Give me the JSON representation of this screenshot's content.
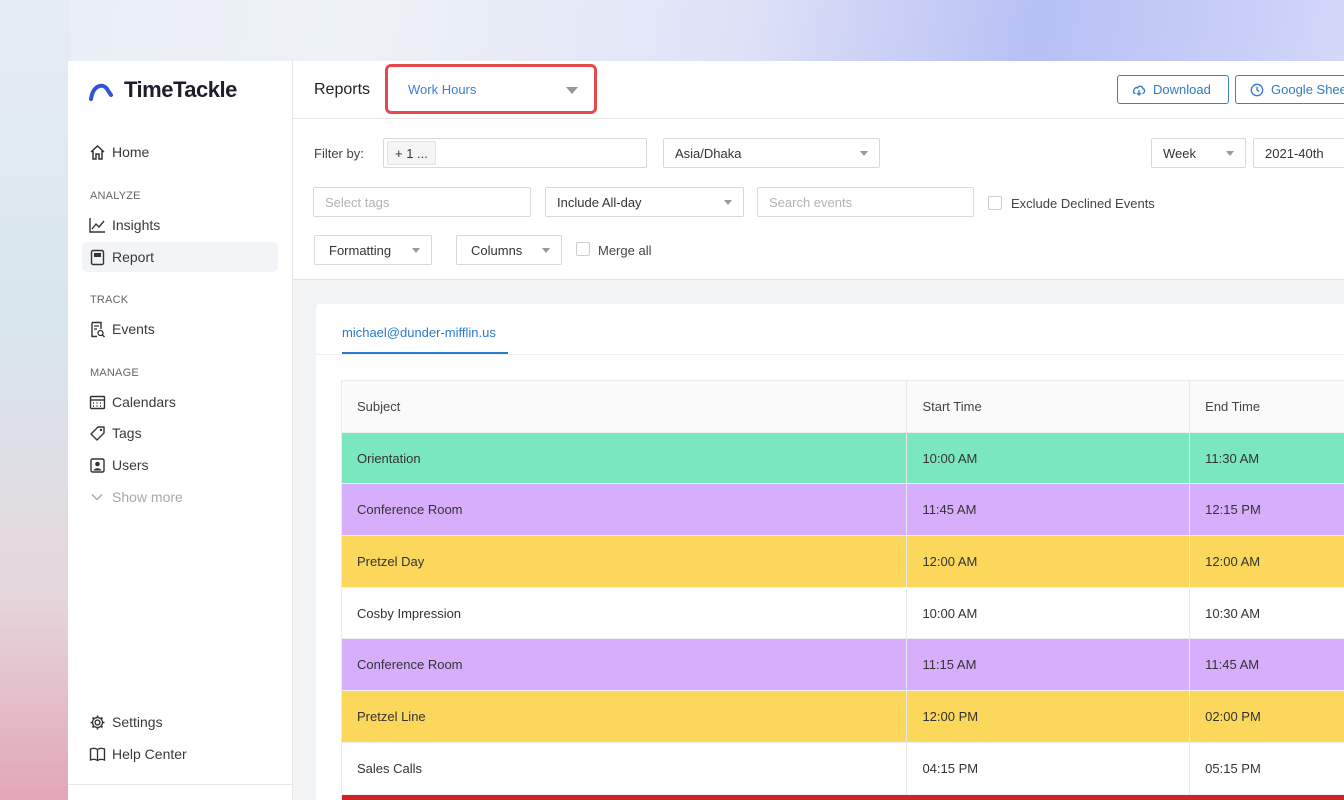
{
  "brand": {
    "name": "TimeTackle",
    "accent": "#2f55d4"
  },
  "sidebar": {
    "home": "Home",
    "sections": {
      "analyze": "ANALYZE",
      "track": "TRACK",
      "manage": "MANAGE"
    },
    "insights": "Insights",
    "report": "Report",
    "events": "Events",
    "calendars": "Calendars",
    "tags": "Tags",
    "users": "Users",
    "show_more": "Show more",
    "settings": "Settings",
    "help_center": "Help Center"
  },
  "header": {
    "title": "Reports",
    "report_type": "Work Hours",
    "download": "Download",
    "google_sheets": "Google Shee"
  },
  "filters": {
    "filter_by_label": "Filter by:",
    "filter_chip": "+ 1 ...",
    "timezone": "Asia/Dhaka",
    "period": "Week",
    "period_value": "2021-40th",
    "tags_placeholder": "Select tags",
    "allday": "Include All-day",
    "search_placeholder": "Search events",
    "exclude_declined": "Exclude Declined Events",
    "formatting": "Formatting",
    "columns": "Columns",
    "merge_all": "Merge all"
  },
  "tab": {
    "user": "michael@dunder-mifflin.us"
  },
  "table": {
    "headers": [
      "Subject",
      "Start Time",
      "End Time"
    ],
    "rows": [
      {
        "subject": "Orientation",
        "start": "10:00 AM",
        "end": "11:30 AM",
        "color": "#7ae7bf"
      },
      {
        "subject": "Conference Room",
        "start": "11:45 AM",
        "end": "12:15 PM",
        "color": "#d7aefb"
      },
      {
        "subject": "Pretzel Day",
        "start": "12:00 AM",
        "end": "12:00 AM",
        "color": "#fbd75b"
      },
      {
        "subject": "Cosby Impression",
        "start": "10:00 AM",
        "end": "10:30 AM",
        "color": "#ffffff"
      },
      {
        "subject": "Conference Room",
        "start": "11:15 AM",
        "end": "11:45 AM",
        "color": "#d7aefb"
      },
      {
        "subject": "Pretzel Line",
        "start": "12:00 PM",
        "end": "02:00 PM",
        "color": "#fbd75b"
      },
      {
        "subject": "Sales Calls",
        "start": "04:15 PM",
        "end": "05:15 PM",
        "color": "#ffffff"
      }
    ]
  }
}
